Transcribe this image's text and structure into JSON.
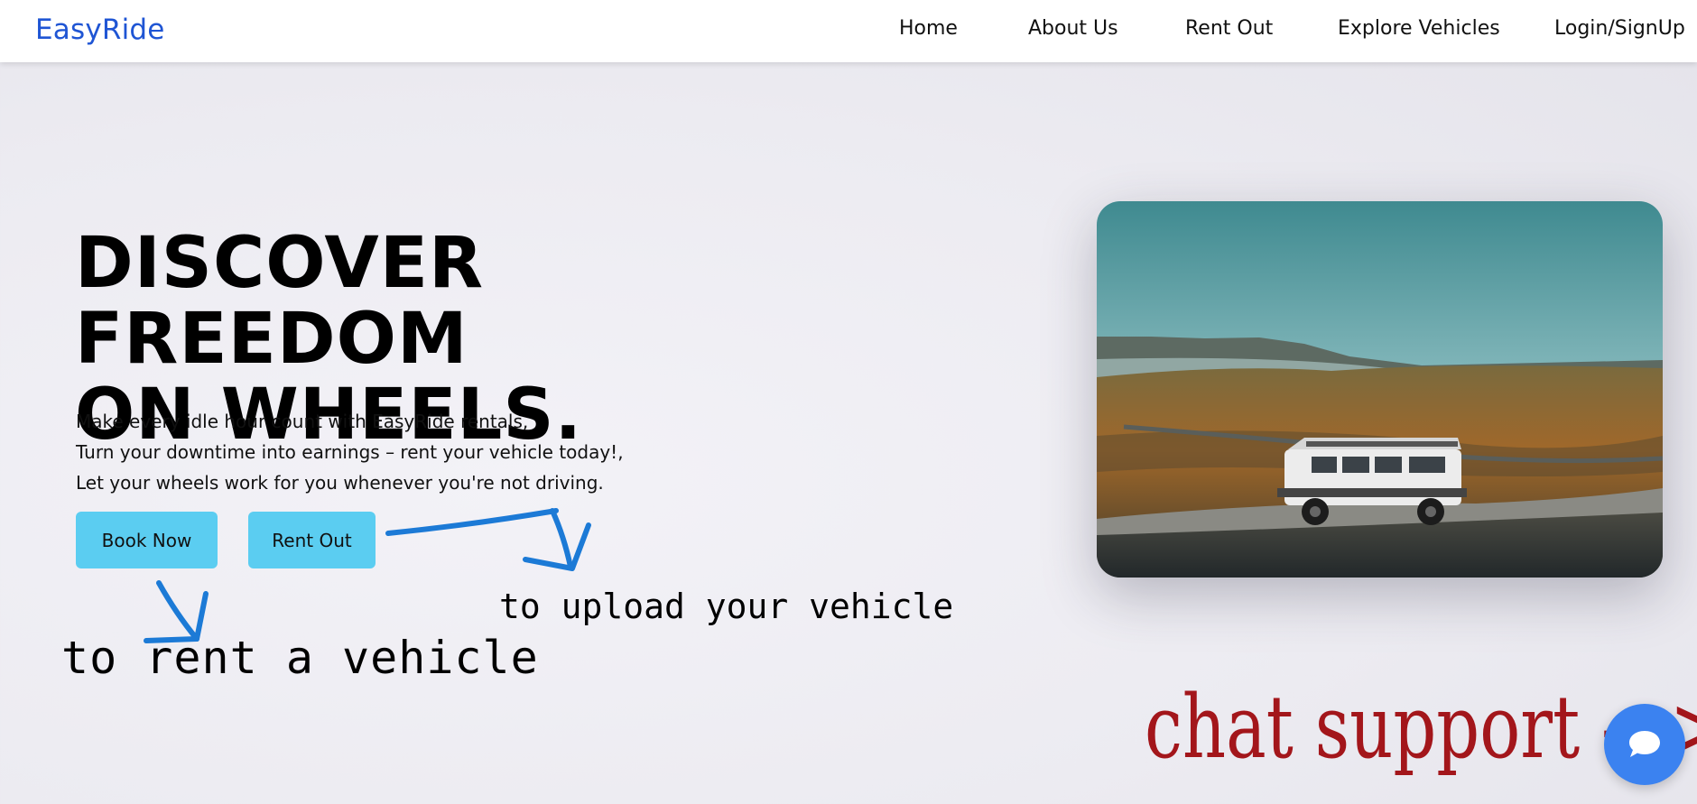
{
  "brand": "EasyRide",
  "nav": {
    "home": "Home",
    "about": "About Us",
    "rent_out": "Rent Out",
    "explore": "Explore Vehicles",
    "login": "Login/SignUp"
  },
  "hero": {
    "title_line1": "DISCOVER FREEDOM",
    "title_line2": "ON WHEELS.",
    "text_line1": "Make every idle hour count with EasyRide rentals,",
    "text_line2": "Turn your downtime into earnings – rent your vehicle today!,",
    "text_line3": "Let your wheels work for you whenever you're not driving.",
    "book_button": "Book Now",
    "rent_button": "Rent Out",
    "image_icon": "suv-landscape-photo"
  },
  "annotations": {
    "rent": "to rent a vehicle",
    "upload": "to upload your vehicle",
    "chat": "chat support  --->"
  },
  "chat_button": {
    "icon": "chat-bubble-icon"
  },
  "colors": {
    "brand": "#1f55d4",
    "button": "#5bcdf1",
    "arrow": "#1c7ad6",
    "chat_annotation": "#a3161b",
    "chat_button": "#3b82f0"
  }
}
